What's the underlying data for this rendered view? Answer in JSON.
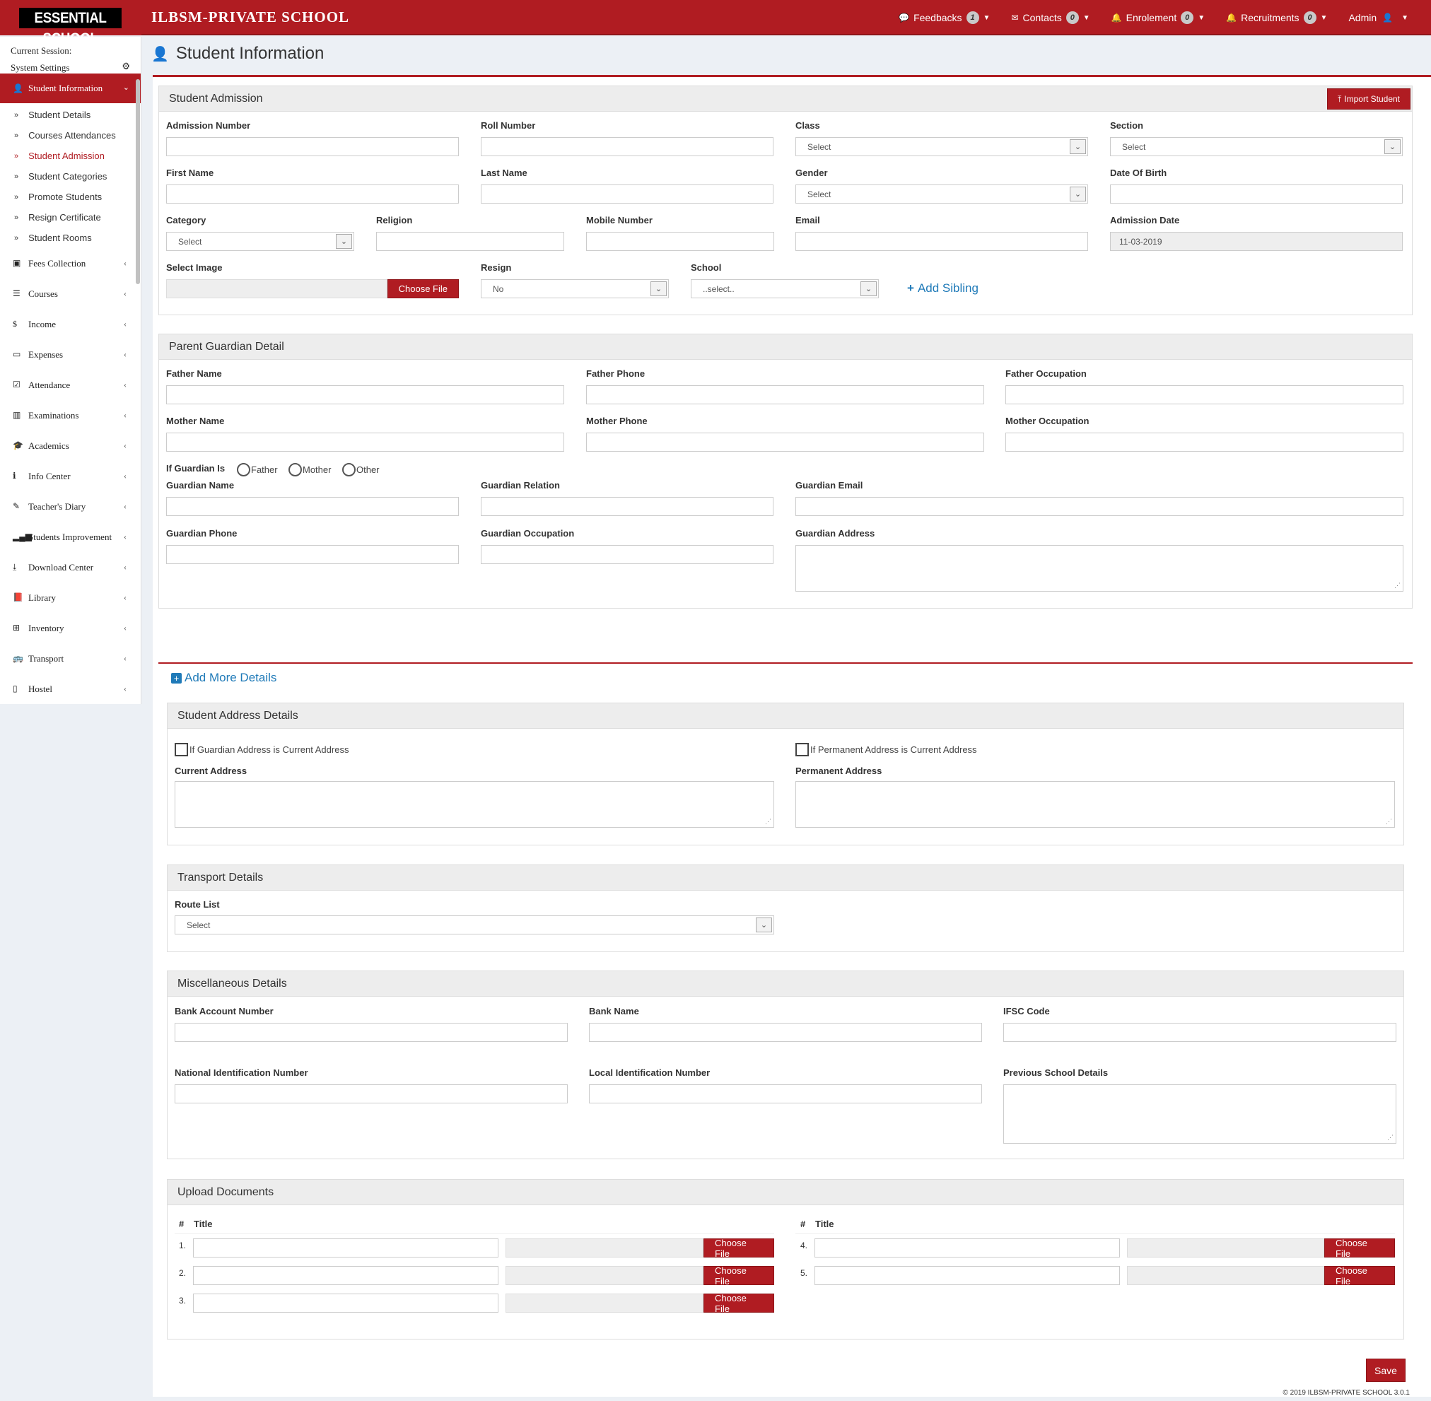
{
  "header": {
    "logo_text": "ESSENTIAL SCHOOL",
    "school_name": "ILBSM-PRIVATE SCHOOL",
    "nav": [
      {
        "label": "Feedbacks",
        "count": "1"
      },
      {
        "label": "Contacts",
        "count": "0"
      },
      {
        "label": "Enrolement",
        "count": "0"
      },
      {
        "label": "Recruitments",
        "count": "0"
      }
    ],
    "user": "Admin"
  },
  "sidebar": {
    "current_session": "Current Session:",
    "system_settings": "System Settings",
    "active": "Student Information",
    "sub_items": [
      "Student Details",
      "Courses Attendances",
      "Student Admission",
      "Student Categories",
      "Promote Students",
      "Resign Certificate",
      "Student Rooms"
    ],
    "items": [
      "Fees Collection",
      "Courses",
      "Income",
      "Expenses",
      "Attendance",
      "Examinations",
      "Academics",
      "Info Center",
      "Teacher's Diary",
      "Students Improvement",
      "Download Center",
      "Library",
      "Inventory",
      "Transport",
      "Hostel"
    ]
  },
  "page": {
    "title": "Student Information",
    "save": "Save",
    "footer": "© 2019 ILBSM-PRIVATE SCHOOL 3.0.1"
  },
  "admission": {
    "title": "Student Admission",
    "import_btn": "Import Student",
    "admission_number": "Admission Number",
    "roll_number": "Roll Number",
    "class": "Class",
    "section": "Section",
    "first_name": "First Name",
    "last_name": "Last Name",
    "gender": "Gender",
    "dob": "Date Of Birth",
    "category": "Category",
    "religion": "Religion",
    "mobile": "Mobile Number",
    "email": "Email",
    "admission_date": "Admission Date",
    "admission_date_value": "11-03-2019",
    "select_image": "Select Image",
    "resign": "Resign",
    "resign_value": "No",
    "school": "School",
    "school_value": "..select..",
    "select": "Select",
    "choose_file": "Choose File",
    "add_sibling": "Add Sibling"
  },
  "guardian": {
    "title": "Parent Guardian Detail",
    "father_name": "Father Name",
    "father_phone": "Father Phone",
    "father_occupation": "Father Occupation",
    "mother_name": "Mother Name",
    "mother_phone": "Mother Phone",
    "mother_occupation": "Mother Occupation",
    "if_guardian_is": "If Guardian Is",
    "opt_father": "Father",
    "opt_mother": "Mother",
    "opt_other": "Other",
    "guardian_name": "Guardian Name",
    "guardian_relation": "Guardian Relation",
    "guardian_email": "Guardian Email",
    "guardian_phone": "Guardian Phone",
    "guardian_occupation": "Guardian Occupation",
    "guardian_address": "Guardian Address"
  },
  "more": {
    "add_more": "Add More Details",
    "address_title": "Student Address Details",
    "chk_guardian": "If Guardian Address is Current Address",
    "chk_permanent": "If Permanent Address is Current Address",
    "current_address": "Current Address",
    "permanent_address": "Permanent Address",
    "transport_title": "Transport Details",
    "route_list": "Route List",
    "misc_title": "Miscellaneous Details",
    "bank_account": "Bank Account Number",
    "bank_name": "Bank Name",
    "ifsc": "IFSC Code",
    "national_id": "National Identification Number",
    "local_id": "Local Identification Number",
    "prev_school": "Previous School Details",
    "upload_title": "Upload Documents",
    "hash": "#",
    "col_title": "Title",
    "rows_left": [
      "1.",
      "2.",
      "3."
    ],
    "rows_right": [
      "4.",
      "5."
    ]
  }
}
